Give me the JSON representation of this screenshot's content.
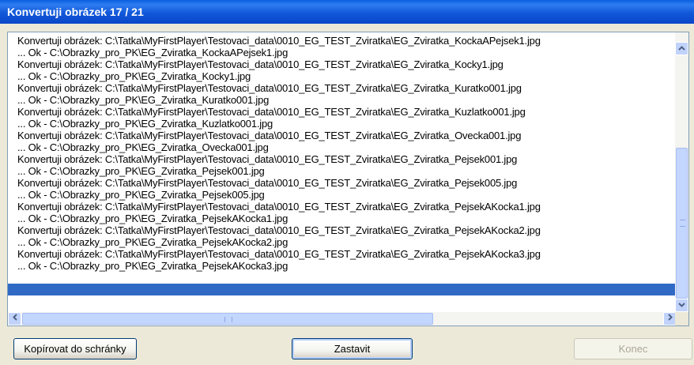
{
  "window": {
    "title": "Konvertuji obrázek 17 / 21"
  },
  "log": {
    "lines": [
      "Konvertuji obrázek: C:\\Tatka\\MyFirstPlayer\\Testovaci_data\\0010_EG_TEST_Zviratka\\EG_Zviratka_KockaAPejsek1.jpg",
      "... Ok - C:\\Obrazky_pro_PK\\EG_Zviratka_KockaAPejsek1.jpg",
      "Konvertuji obrázek: C:\\Tatka\\MyFirstPlayer\\Testovaci_data\\0010_EG_TEST_Zviratka\\EG_Zviratka_Kocky1.jpg",
      "... Ok - C:\\Obrazky_pro_PK\\EG_Zviratka_Kocky1.jpg",
      "Konvertuji obrázek: C:\\Tatka\\MyFirstPlayer\\Testovaci_data\\0010_EG_TEST_Zviratka\\EG_Zviratka_Kuratko001.jpg",
      "... Ok - C:\\Obrazky_pro_PK\\EG_Zviratka_Kuratko001.jpg",
      "Konvertuji obrázek: C:\\Tatka\\MyFirstPlayer\\Testovaci_data\\0010_EG_TEST_Zviratka\\EG_Zviratka_Kuzlatko001.jpg",
      "... Ok - C:\\Obrazky_pro_PK\\EG_Zviratka_Kuzlatko001.jpg",
      "Konvertuji obrázek: C:\\Tatka\\MyFirstPlayer\\Testovaci_data\\0010_EG_TEST_Zviratka\\EG_Zviratka_Ovecka001.jpg",
      "... Ok - C:\\Obrazky_pro_PK\\EG_Zviratka_Ovecka001.jpg",
      "Konvertuji obrázek: C:\\Tatka\\MyFirstPlayer\\Testovaci_data\\0010_EG_TEST_Zviratka\\EG_Zviratka_Pejsek001.jpg",
      "... Ok - C:\\Obrazky_pro_PK\\EG_Zviratka_Pejsek001.jpg",
      "Konvertuji obrázek: C:\\Tatka\\MyFirstPlayer\\Testovaci_data\\0010_EG_TEST_Zviratka\\EG_Zviratka_Pejsek005.jpg",
      "... Ok - C:\\Obrazky_pro_PK\\EG_Zviratka_Pejsek005.jpg",
      "Konvertuji obrázek: C:\\Tatka\\MyFirstPlayer\\Testovaci_data\\0010_EG_TEST_Zviratka\\EG_Zviratka_PejsekAKocka1.jpg",
      "... Ok - C:\\Obrazky_pro_PK\\EG_Zviratka_PejsekAKocka1.jpg",
      "Konvertuji obrázek: C:\\Tatka\\MyFirstPlayer\\Testovaci_data\\0010_EG_TEST_Zviratka\\EG_Zviratka_PejsekAKocka2.jpg",
      "... Ok - C:\\Obrazky_pro_PK\\EG_Zviratka_PejsekAKocka2.jpg",
      "Konvertuji obrázek: C:\\Tatka\\MyFirstPlayer\\Testovaci_data\\0010_EG_TEST_Zviratka\\EG_Zviratka_PejsekAKocka3.jpg",
      "... Ok - C:\\Obrazky_pro_PK\\EG_Zviratka_PejsekAKocka3.jpg"
    ],
    "selected_index": 21
  },
  "scrollbar": {
    "up_icon": "chevron-up-icon",
    "down_icon": "chevron-down-icon",
    "left_icon": "chevron-left-icon",
    "right_icon": "chevron-right-icon"
  },
  "buttons": {
    "copy_label": "Kopírovat do schránky",
    "stop_label": "Zastavit",
    "end_label": "Konec"
  },
  "colors": {
    "titlebar": "#0A5FE0",
    "selection": "#316AC5",
    "dialog_bg": "#ECE9D8"
  }
}
